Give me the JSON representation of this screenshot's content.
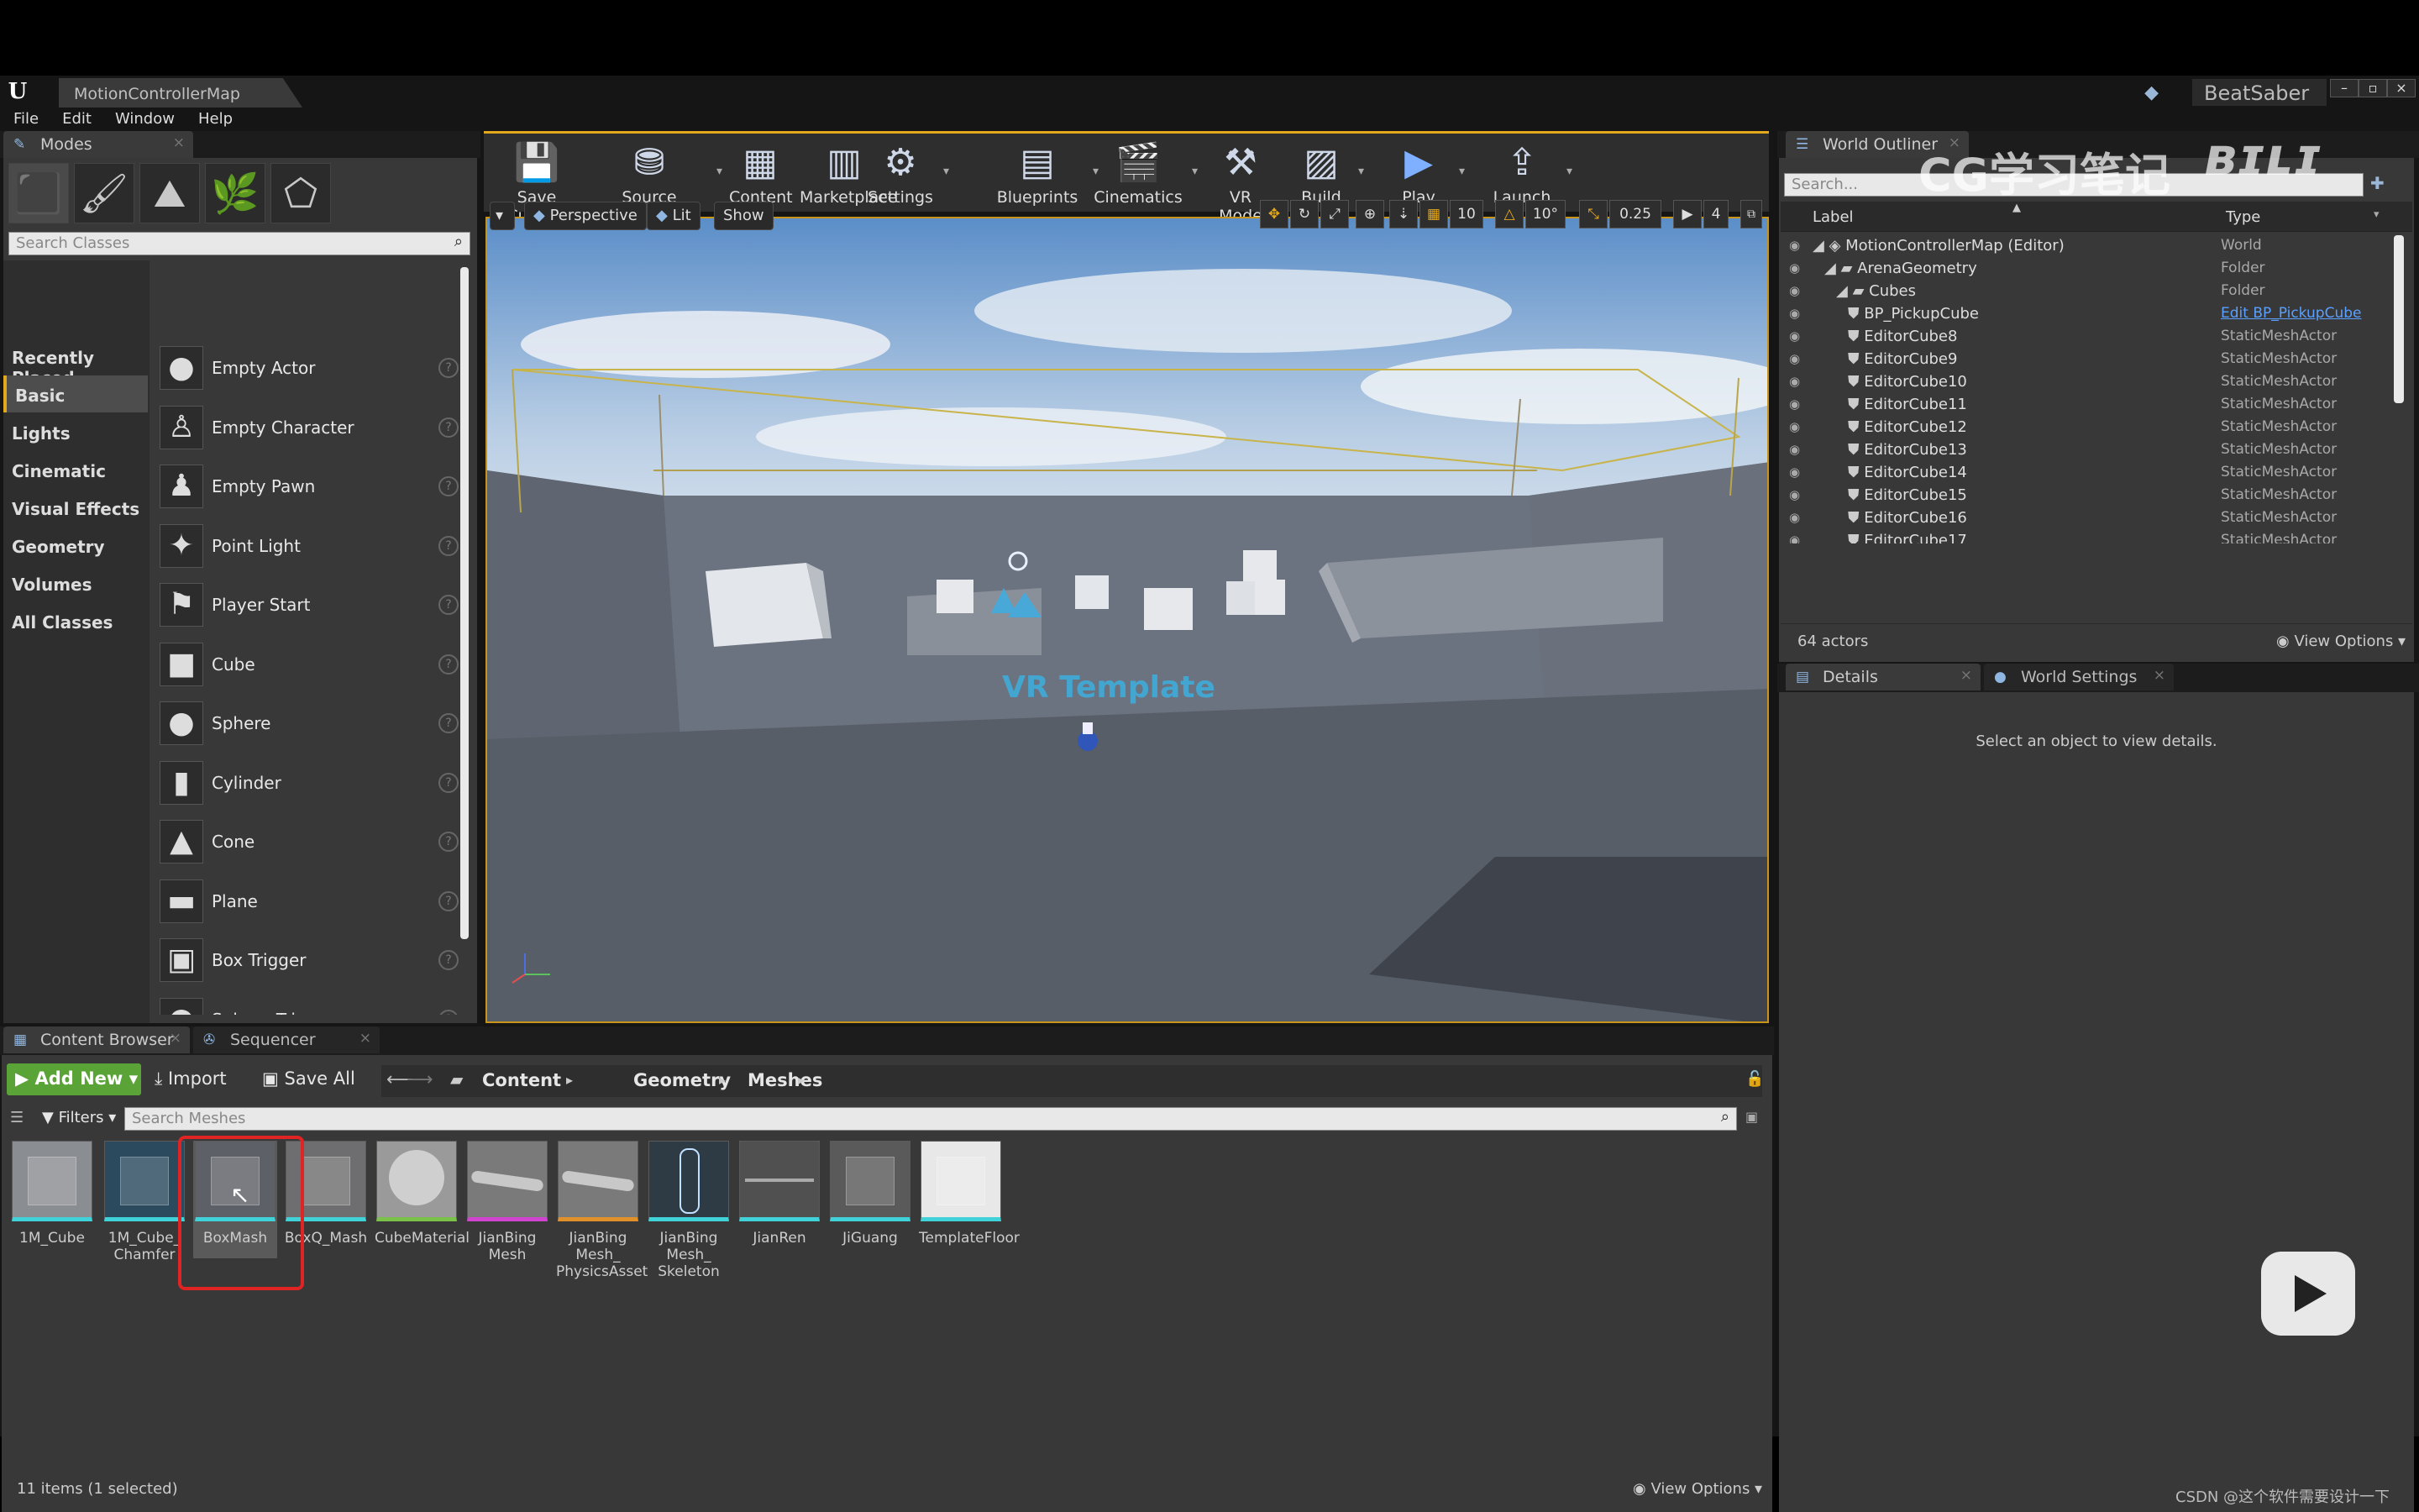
{
  "window": {
    "tab": "MotionControllerMap",
    "project": "BeatSaber"
  },
  "menu": [
    "File",
    "Edit",
    "Window",
    "Help"
  ],
  "modes": {
    "tab": "Modes",
    "search_placeholder": "Search Classes",
    "categories": [
      "Recently Placed",
      "Basic",
      "Lights",
      "Cinematic",
      "Visual Effects",
      "Geometry",
      "Volumes",
      "All Classes"
    ],
    "items": [
      "Empty Actor",
      "Empty Character",
      "Empty Pawn",
      "Point Light",
      "Player Start",
      "Cube",
      "Sphere",
      "Cylinder",
      "Cone",
      "Plane",
      "Box Trigger",
      "Sphere Trigger"
    ]
  },
  "toolbar": [
    "Save Current",
    "Source Control",
    "Content",
    "Marketplace",
    "Settings",
    "Blueprints",
    "Cinematics",
    "VR Mode",
    "Build",
    "Play",
    "Launch"
  ],
  "viewport": {
    "perspective": "Perspective",
    "lit": "Lit",
    "show": "Show",
    "grid": "10",
    "rot": "10°",
    "scale": "0.25",
    "speed": "4",
    "watermark_text": "VR Template"
  },
  "outliner": {
    "tab": "World Outliner",
    "search_placeholder": "Search...",
    "col_label": "Label",
    "col_type": "Type",
    "rows": [
      {
        "name": "MotionControllerMap (Editor)",
        "type": "World"
      },
      {
        "name": "ArenaGeometry",
        "type": "Folder"
      },
      {
        "name": "Cubes",
        "type": "Folder"
      },
      {
        "name": "BP_PickupCube",
        "type": "Edit BP_PickupCube"
      },
      {
        "name": "EditorCube8",
        "type": "StaticMeshActor"
      },
      {
        "name": "EditorCube9",
        "type": "StaticMeshActor"
      },
      {
        "name": "EditorCube10",
        "type": "StaticMeshActor"
      },
      {
        "name": "EditorCube11",
        "type": "StaticMeshActor"
      },
      {
        "name": "EditorCube12",
        "type": "StaticMeshActor"
      },
      {
        "name": "EditorCube13",
        "type": "StaticMeshActor"
      },
      {
        "name": "EditorCube14",
        "type": "StaticMeshActor"
      },
      {
        "name": "EditorCube15",
        "type": "StaticMeshActor"
      },
      {
        "name": "EditorCube16",
        "type": "StaticMeshActor"
      },
      {
        "name": "EditorCube17",
        "type": "StaticMeshActor"
      }
    ],
    "count": "64 actors",
    "view_options": "View Options"
  },
  "details": {
    "tab": "Details",
    "tab2": "World Settings",
    "empty": "Select an object to view details."
  },
  "content": {
    "tab": "Content Browser",
    "tab2": "Sequencer",
    "add_new": "Add New",
    "import": "Import",
    "save_all": "Save All",
    "path": [
      "Content",
      "Geometry",
      "Meshes"
    ],
    "filters": "Filters",
    "search_placeholder": "Search Meshes",
    "assets": [
      "1M_Cube",
      "1M_Cube_\nChamfer",
      "BoxMash",
      "BoxQ_Mash",
      "CubeMaterial",
      "JianBing\nMesh",
      "JianBing\nMesh_\nPhysicsAsset",
      "JianBing\nMesh_\nSkeleton",
      "JianRen",
      "JiGuang",
      "TemplateFloor"
    ],
    "status": "11 items (1 selected)",
    "view_options": "View Options"
  },
  "overlay": {
    "watermark": "CG学习笔记",
    "credit": "CSDN @这个软件需要设计一下"
  }
}
